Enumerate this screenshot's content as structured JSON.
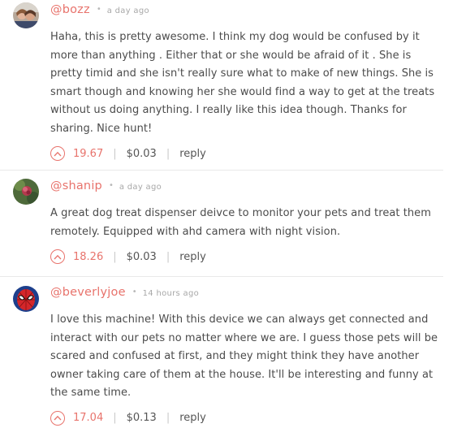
{
  "comments": [
    {
      "username": "@bozz",
      "time": "a day ago",
      "text": "Haha, this is pretty awesome. I think my dog would be confused by it more than anything . Either that or she would be afraid of it . She is pretty timid and she isn't really sure what to make of new things. She is smart though and knowing her she would find a way to get at the treats without us doing anything. I really like this idea though. Thanks for sharing. Nice hunt!",
      "score": "19.67",
      "payout": "$0.03",
      "reply_label": "reply",
      "avatar_icon": "user-photo-avatar"
    },
    {
      "username": "@shanip",
      "time": "a day ago",
      "text": "A great dog treat dispenser deivce to monitor your pets and treat them remotely. Equipped with ahd camera with night vision.",
      "score": "18.26",
      "payout": "$0.03",
      "reply_label": "reply",
      "avatar_icon": "flower-avatar"
    },
    {
      "username": "@beverlyjoe",
      "time": "14 hours ago",
      "text": "I love this machine! With this device we can always get connected and interact with our pets no matter where we are. I guess those pets will be scared and confused at first, and they might think they have another owner taking care of them at the house. It'll be interesting and funny at the same time.",
      "score": "17.04",
      "payout": "$0.13",
      "reply_label": "reply",
      "avatar_icon": "spiderman-avatar"
    }
  ],
  "colors": {
    "accent": "#e8736c",
    "text": "#4b4b4b",
    "muted": "#a8a8a8",
    "divider": "#e9e9e9"
  }
}
